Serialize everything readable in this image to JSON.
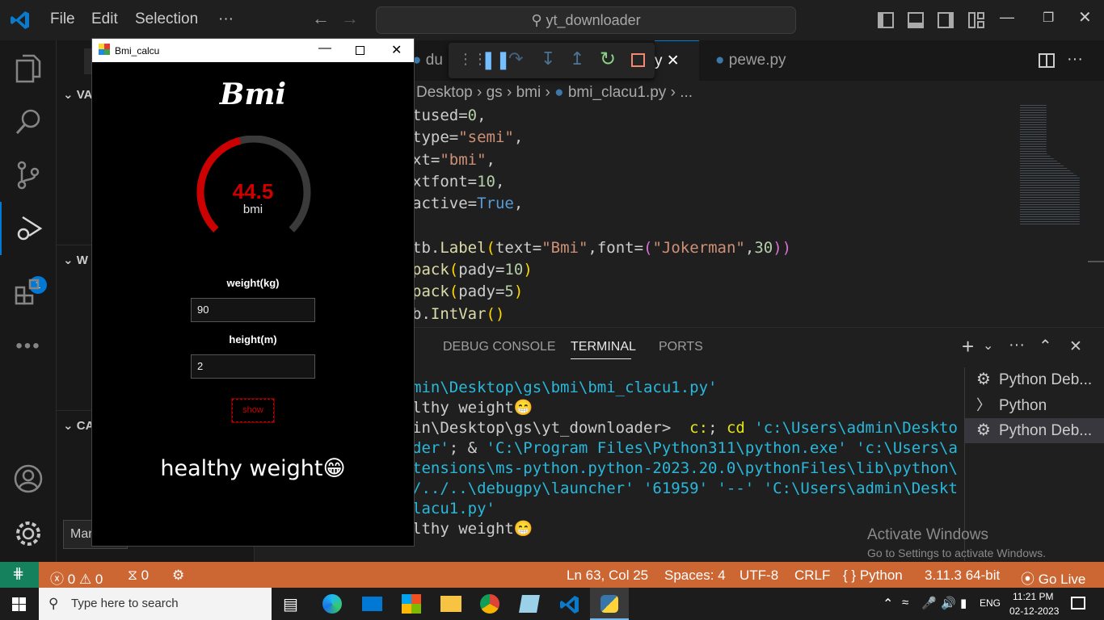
{
  "menu": {
    "file": "File",
    "edit": "Edit",
    "selection": "Selection",
    "more": "···"
  },
  "search": {
    "text": "yt_downloader"
  },
  "activity": {
    "debug_badge": "1"
  },
  "sidebar": {
    "sections": [
      "VA",
      "W",
      "CA"
    ],
    "manage_tooltip": "Man"
  },
  "tabs": [
    {
      "label": "du"
    },
    {
      "label": "y"
    },
    {
      "label": "pewe.py"
    }
  ],
  "breadcrumb": [
    "Desktop",
    "gs",
    "bmi",
    "bmi_clacu1.py",
    "..."
  ],
  "code": {
    "line1_a": "tused=",
    "line1_n": "0",
    "line1_b": ",",
    "line2_a": "type=",
    "line2_s": "\"semi\"",
    "line2_b": ",",
    "line3_a": "xt=",
    "line3_s": "\"bmi\"",
    "line3_b": ",",
    "line4_a": "xtfont=",
    "line4_n": "10",
    "line4_b": ",",
    "line5_a": "active=",
    "line5_k": "True",
    "line5_b": ",",
    "line6_a": "tb.",
    "line6_f": "Label",
    "line6_p1": "(",
    "line6_b": "text=",
    "line6_s": "\"Bmi\"",
    "line6_c": ",font=",
    "line6_p2": "(",
    "line6_s2": "\"Jokerman\"",
    "line6_d": ",",
    "line6_n": "30",
    "line6_p3": "))",
    "line7_a": "pack",
    "line7_p1": "(",
    "line7_b": "pady=",
    "line7_n": "10",
    "line7_p2": ")",
    "line8_a": "pack",
    "line8_p1": "(",
    "line8_b": "pady=",
    "line8_n": "5",
    "line8_p2": ")",
    "line9_a": "b.",
    "line9_f": "IntVar",
    "line9_p": "()"
  },
  "panel": {
    "tabs": [
      "DEBUG CONSOLE",
      "TERMINAL",
      "PORTS"
    ],
    "active_tab": "TERMINAL"
  },
  "terminal": {
    "l1": "min\\Desktop\\gs\\bmi\\bmi_clacu1.py'",
    "l2": "lthy weight😁",
    "l3_a": "in\\Desktop\\gs\\yt_downloader>  ",
    "l3_b": "c:",
    "l3_c": "; ",
    "l3_d": "cd",
    "l3_e": " 'c:\\Users\\admin\\Deskto",
    "l4_a": "der'",
    "l4_b": "; & ",
    "l4_c": "'C:\\Program Files\\Python311\\python.exe' 'c:\\Users\\a",
    "l5": "tensions\\ms-python.python-2023.20.0\\pythonFiles\\lib\\python\\",
    "l6": "/../..\\debugpy\\launcher' '61959' '--' 'C:\\Users\\admin\\Deskt",
    "l7": "lacu1.py'",
    "l8": "lthy weight😁"
  },
  "terminal_list": [
    "Python Deb...",
    "Python",
    "Python Deb..."
  ],
  "activate": {
    "title": "Activate Windows",
    "subtitle": "Go to Settings to activate Windows."
  },
  "status": {
    "errors": "0",
    "warnings": "0",
    "ports": "0",
    "position": "Ln 63, Col 25",
    "spaces": "Spaces: 4",
    "encoding": "UTF-8",
    "eol": "CRLF",
    "language": "Python",
    "interpreter": "3.11.3 64-bit",
    "golive": "Go Live"
  },
  "taskbar": {
    "search_placeholder": "Type here to search",
    "lang": "ENG",
    "time": "11:21 PM",
    "date": "02-12-2023"
  },
  "tkapp": {
    "title": "Bmi_calcu",
    "heading": "Bmi",
    "meter_value": "44.5",
    "meter_sub": "bmi",
    "weight_label": "weight(kg)",
    "weight_value": "90",
    "height_label": "height(m)",
    "height_value": "2",
    "show_button": "show",
    "result": "healthy weight😁",
    "meter_fraction": 0.445
  },
  "colors": {
    "status": "#cc6633",
    "remote": "#16825d",
    "accent": "#0078d4",
    "meter": "#cc0000"
  }
}
